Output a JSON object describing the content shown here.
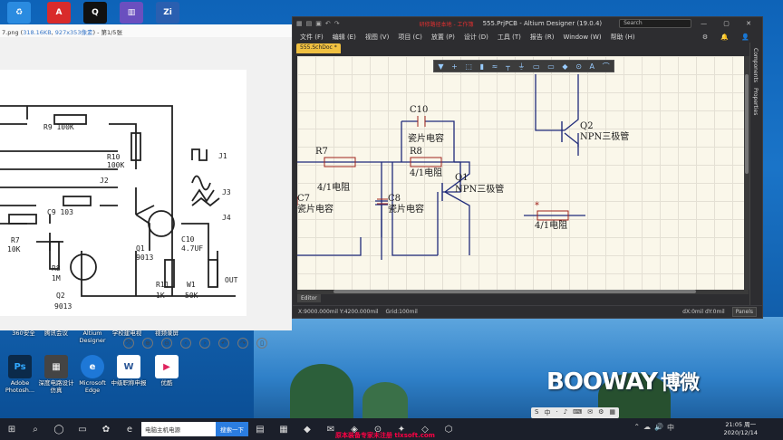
{
  "desktop": {
    "top_icons": [
      {
        "name": "recycle-bin-icon",
        "color": "#2a8be0",
        "glyph": "♻"
      },
      {
        "name": "pdf-icon",
        "color": "#d92b2b",
        "glyph": "A"
      },
      {
        "name": "qq-icon",
        "color": "#111111",
        "glyph": "Q"
      },
      {
        "name": "app-icon",
        "color": "#6a4fbf",
        "glyph": "▥"
      },
      {
        "name": "zj-icon",
        "color": "#2a5fb0",
        "glyph": "Zi"
      }
    ],
    "icons_row1_labels": [
      "360安全",
      "腾讯会议",
      "Altium Designer",
      "学校建电视",
      "视频录屏"
    ],
    "icons_row2": [
      {
        "label": "Adobe Photosh...",
        "glyph": "Ps",
        "color": "#0b2a4a"
      },
      {
        "label": "深度电路设计仿真",
        "glyph": "▦",
        "color": "#444444"
      },
      {
        "label": "Microsoft Edge",
        "glyph": "e",
        "color": "#1e78d7"
      },
      {
        "label": "中级职称申报",
        "glyph": "W",
        "color": "#2b5797"
      },
      {
        "label": "优酷",
        "glyph": "▶",
        "color": "#ffffff"
      }
    ],
    "brand_text": "BOOWAY",
    "brand_cn": "博微"
  },
  "viewer": {
    "filename": "7.png",
    "size_link": "318.16KB",
    "dims_link": "927x353像素",
    "page": "第1/5张",
    "schematic_labels": [
      "J1",
      "J2",
      "J3",
      "J4",
      "R9 100K",
      "R10",
      "100K",
      "C9 103",
      "R7",
      "10K",
      "R8",
      "1M",
      "Q2",
      "9013",
      "Q1",
      "9013",
      "C10",
      "4.7UF",
      "R11",
      "1K",
      "W1",
      "50K",
      "OUT"
    ],
    "tools": [
      "⤧",
      "⊕",
      "⊖",
      "‹",
      "›",
      "↶",
      "↷",
      "▯"
    ]
  },
  "altium": {
    "title": "555.PrjPCB - Altium Designer (19.0.4)",
    "red_title": "研修路径本地 - 工作簿",
    "search_placeholder": "Search",
    "window_buttons": "— ▢ ✕",
    "menu": [
      "文件 (F)",
      "编辑 (E)",
      "视图 (V)",
      "项目 (C)",
      "放置 (P)",
      "设计 (D)",
      "工具 (T)",
      "报告 (R)",
      "Window (W)",
      "帮助 (H)"
    ],
    "menu_right": "⚙ 🔔 👤",
    "doc_tab": "555.SchDoc *",
    "float_tools": [
      "▼",
      "+",
      "⬚",
      "▮",
      "≈",
      "┬",
      "⏚",
      "▭",
      "▭",
      "◆",
      "⊙",
      "A",
      "⌒"
    ],
    "side_panels": [
      "Components",
      "Properties"
    ],
    "editor_tab": "Editor",
    "status_coords": "X:9000.000mil Y:4200.000mil",
    "status_grid": "Grid:100mil",
    "status_dx": "dX:0mil dY:0mil",
    "panels_button": "Panels",
    "schematic": {
      "c10": "C10",
      "c10_desc": "瓷片电容",
      "r7": "R7",
      "r7_desc": "4/1电阻",
      "r8": "R8",
      "r8_desc": "4/1电阻",
      "c7": "C7",
      "c7_desc": "瓷片电容",
      "c8": "C8",
      "c8_desc": "瓷片电容",
      "q1": "Q1",
      "q1_desc": "NPN三极管",
      "q2": "Q2",
      "q2_desc": "NPN三极管",
      "r_float": "*",
      "r_float_desc": "4/1电阻"
    }
  },
  "taskbar": {
    "search_text": "电脑主机电源",
    "search_button": "搜索一下",
    "url_text": "原本装备专家未注册 tlxsoft.com",
    "time": "21:05 周一",
    "date": "2020/12/14",
    "tray_float": [
      "S",
      "中",
      "·",
      "♪",
      "⌨",
      "✉",
      "⚙",
      "▦"
    ],
    "tray_icons": [
      "⌃",
      "☁",
      "🔊",
      "中"
    ]
  }
}
